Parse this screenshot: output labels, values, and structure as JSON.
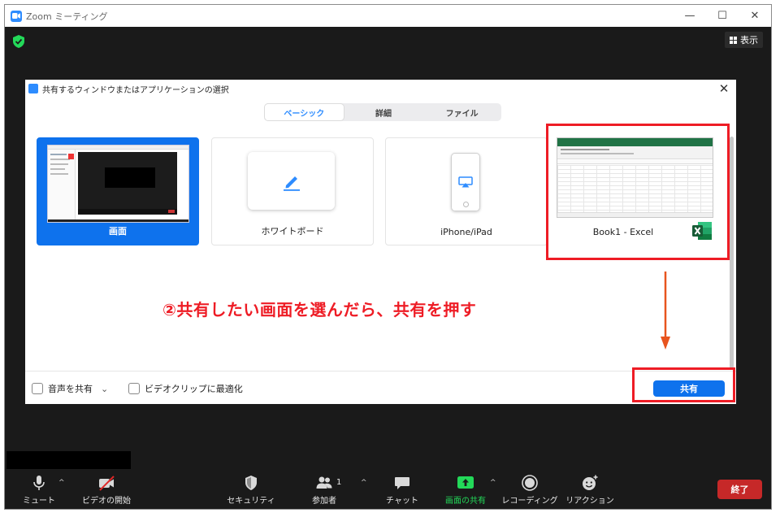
{
  "window": {
    "title": "Zoom ミーティング",
    "controls": {
      "minimize": "—",
      "maximize": "☐",
      "close": "✕"
    }
  },
  "meeting": {
    "view_button": "表示"
  },
  "dialog": {
    "title": "共有するウィンドウまたはアプリケーションの選択",
    "close": "✕",
    "tabs": [
      {
        "label": "ベーシック",
        "active": true
      },
      {
        "label": "詳細",
        "active": false
      },
      {
        "label": "ファイル",
        "active": false
      }
    ],
    "options": [
      {
        "label": "画面",
        "selected": true
      },
      {
        "label": "ホワイトボード",
        "selected": false
      },
      {
        "label": "iPhone/iPad",
        "selected": false
      },
      {
        "label": "Book1 - Excel",
        "selected": false
      }
    ],
    "footer": {
      "share_audio": "音声を共有",
      "share_audio_caret": "⌄",
      "optimize_video": "ビデオクリップに最適化",
      "share_button": "共有"
    }
  },
  "annotation": {
    "instruction": "②共有したい画面を選んだら、共有を押す",
    "color": "#ee1c25",
    "arrow_color": "#e8541e"
  },
  "toolbar": {
    "mute": "ミュート",
    "video": "ビデオの開始",
    "security": "セキュリティ",
    "participants": "参加者",
    "participants_count": "1",
    "chat": "チャット",
    "share_screen": "画面の共有",
    "recording": "レコーディング",
    "reactions": "リアクション",
    "end": "終了",
    "caret": "^"
  },
  "colors": {
    "accent": "#0e72ed",
    "share_green": "#23d959",
    "end_red": "#c62828"
  }
}
